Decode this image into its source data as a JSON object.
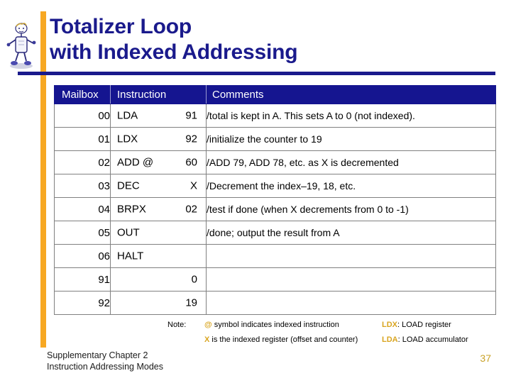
{
  "slide": {
    "title_line1": "Totalizer Loop",
    "title_line2": "with Indexed Addressing",
    "title_color": "#1a1a8c",
    "accent_color": "#f7a823",
    "clipart_name": "cartoon-figure-clipart"
  },
  "table": {
    "headers": {
      "mailbox": "Mailbox",
      "instruction": "Instruction",
      "comments": "Comments"
    },
    "header_bg": "#151590",
    "rows": [
      {
        "mailbox": "00",
        "op": "LDA",
        "arg": "91",
        "comment": "/total is kept in A. This sets A to 0 (not indexed)."
      },
      {
        "mailbox": "01",
        "op": "LDX",
        "arg": "92",
        "comment": "/initialize the counter to 19"
      },
      {
        "mailbox": "02",
        "op": "ADD @",
        "arg": "60",
        "comment": "/ADD 79, ADD 78, etc. as X is decremented"
      },
      {
        "mailbox": "03",
        "op": "DEC",
        "arg": "X",
        "comment": "/Decrement the index–19, 18, etc."
      },
      {
        "mailbox": "04",
        "op": "BRPX",
        "arg": "02",
        "comment": "/test if done (when X decrements from 0 to -1)"
      },
      {
        "mailbox": "05",
        "op": "OUT",
        "arg": "",
        "comment": "/done; output the result from A"
      },
      {
        "mailbox": "06",
        "op": "HALT",
        "arg": "",
        "comment": ""
      },
      {
        "mailbox": "91",
        "op": "",
        "arg": "0",
        "comment": ""
      },
      {
        "mailbox": "92",
        "op": "",
        "arg": "19",
        "comment": ""
      }
    ]
  },
  "notes": {
    "label": "Note:",
    "symbol_at": "@",
    "at_text": " symbol indicates indexed instruction",
    "symbol_x": "X",
    "x_text": " is the indexed register (offset and counter)",
    "ldx_key": "LDX",
    "ldx_text": ": LOAD register",
    "lda_key": "LDA",
    "lda_text": ": LOAD accumulator",
    "highlight_color": "#d9a520"
  },
  "footer": {
    "line1": "Supplementary Chapter 2",
    "line2": "Instruction Addressing Modes",
    "page_number": "37",
    "page_number_color": "#c9a227"
  }
}
